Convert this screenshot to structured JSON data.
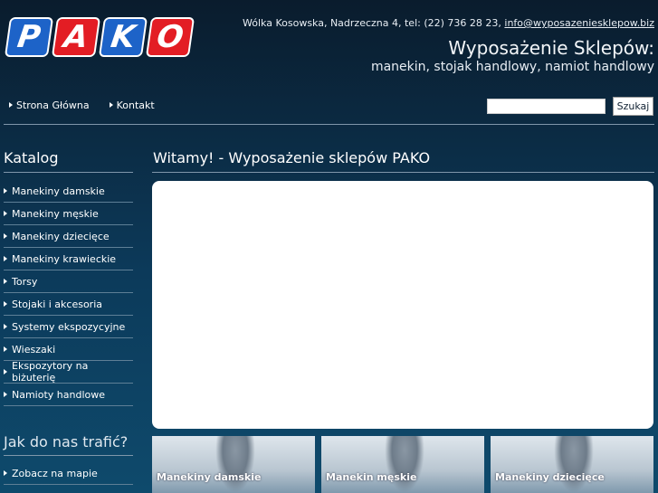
{
  "logo": {
    "letters": [
      "P",
      "A",
      "K",
      "O"
    ]
  },
  "header": {
    "contact_text": "Wólka Kosowska, Nadrzeczna 4, tel: (22) 736 28 23,",
    "email": "info@wyposazeniesklepow.biz",
    "title": "Wyposażenie Sklepów:",
    "subtitle": "manekin, stojak handlowy, namiot handlowy"
  },
  "nav": {
    "items": [
      {
        "label": "Strona Główna"
      },
      {
        "label": "Kontakt"
      }
    ],
    "search_value": "",
    "search_button": "Szukaj"
  },
  "sidebar": {
    "title": "Katalog",
    "items": [
      {
        "label": "Manekiny damskie"
      },
      {
        "label": "Manekiny męskie"
      },
      {
        "label": "Manekiny dziecięce"
      },
      {
        "label": "Manekiny krawieckie"
      },
      {
        "label": "Torsy"
      },
      {
        "label": "Stojaki i akcesoria"
      },
      {
        "label": "Systemy ekspozycyjne"
      },
      {
        "label": "Wieszaki"
      },
      {
        "label": "Ekspozytory na biżuterię"
      },
      {
        "label": "Namioty handlowe"
      }
    ],
    "title2": "Jak do nas trafić?",
    "items2": [
      {
        "label": "Zobacz na mapie"
      }
    ]
  },
  "main": {
    "title": "Witamy! - Wyposażenie sklepów PAKO",
    "thumbs": [
      {
        "caption": "Manekiny damskie"
      },
      {
        "caption": "Manekin męskie"
      },
      {
        "caption": "Manekiny dziecięce"
      }
    ]
  },
  "colors": {
    "logo_blue": "#1d63c8",
    "logo_red": "#e31d24",
    "background": "#0b2a42"
  }
}
